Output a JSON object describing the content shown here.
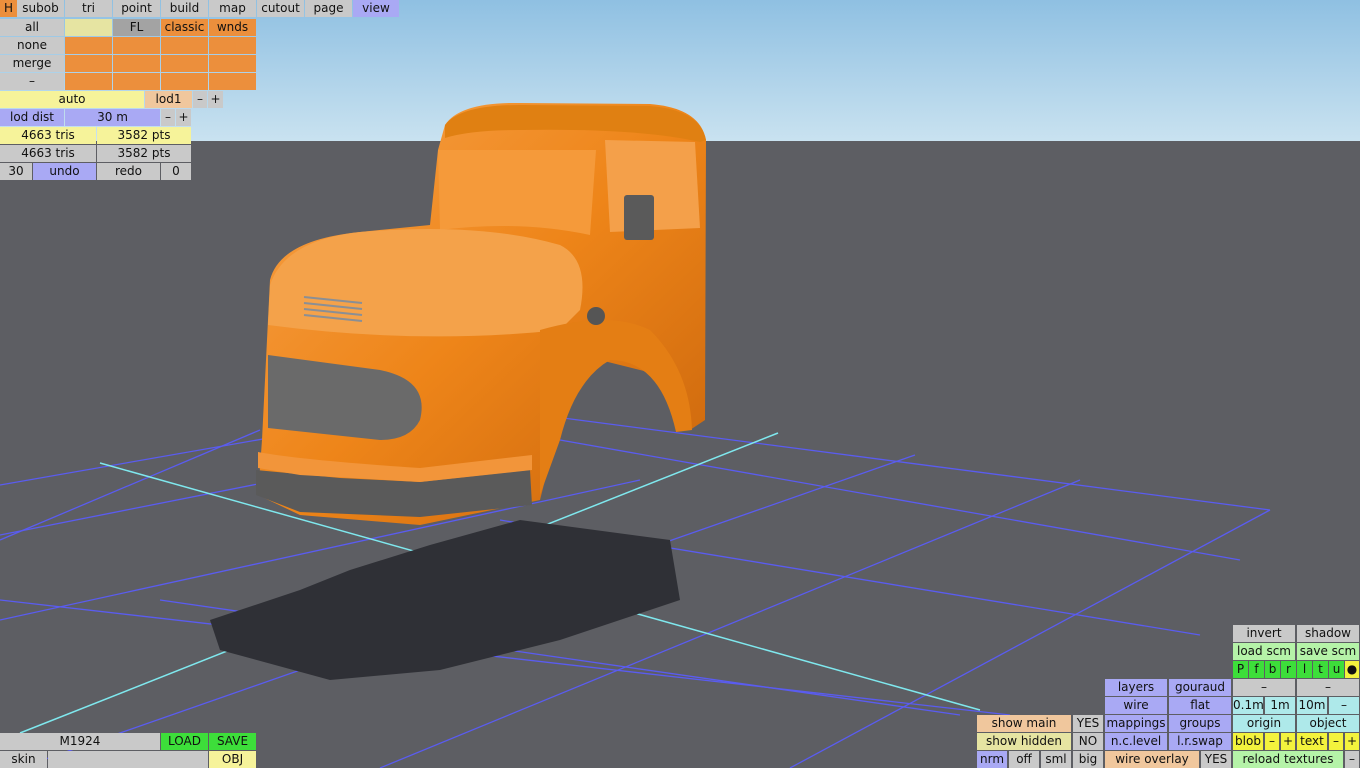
{
  "tabs": {
    "h": "H",
    "subob": "subob",
    "tri": "tri",
    "point": "point",
    "build": "build",
    "map": "map",
    "cutout": "cutout",
    "page": "page",
    "view": "view"
  },
  "selection": {
    "all": "all",
    "none": "none",
    "merge": "merge",
    "minus": "–",
    "fl": "FL",
    "classic": "classic",
    "wnds": "wnds"
  },
  "lod": {
    "auto": "auto",
    "lod": "lod1",
    "minus": "–",
    "plus": "+",
    "dist_label": "lod dist",
    "dist_value": "30 m"
  },
  "stats": {
    "tris1": "4663 tris",
    "pts1": "3582 pts",
    "tris2": "4663 tris",
    "pts2": "3582 pts"
  },
  "history": {
    "count": "30",
    "undo": "undo",
    "redo": "redo",
    "redo_count": "0"
  },
  "file": {
    "name": "M1924",
    "load": "LOAD",
    "save": "SAVE",
    "skin": "skin",
    "obj": "OBJ"
  },
  "right": {
    "invert": "invert",
    "shadow": "shadow",
    "load_scm": "load scm",
    "save_scm": "save scm",
    "views": [
      "P",
      "f",
      "b",
      "r",
      "l",
      "t",
      "u",
      "●"
    ],
    "layers": "layers",
    "gouraud": "gouraud",
    "dash1": "–",
    "dash2": "–",
    "wire": "wire",
    "flat": "flat",
    "step1": "0.1m",
    "step2": "1m",
    "step3": "10m",
    "step_minus": "–",
    "show_main": "show main",
    "show_main_val": "YES",
    "mappings": "mappings",
    "groups": "groups",
    "origin": "origin",
    "object": "object",
    "show_hidden": "show hidden",
    "show_hidden_val": "NO",
    "nclevel": "n.c.level",
    "lrswap": "l.r.swap",
    "blob": "blob",
    "blob_minus": "–",
    "blob_plus": "+",
    "text": "text",
    "text_minus": "–",
    "text_plus": "+",
    "nrm": "nrm",
    "off": "off",
    "sml": "sml",
    "big": "big",
    "wire_overlay": "wire overlay",
    "wire_overlay_val": "YES",
    "reload": "reload textures",
    "reload_minus": "–"
  },
  "colors": {
    "sky_top": "#94c3e3",
    "ground": "#5d5e63",
    "truck": "#f08b1f",
    "grid": "#5a5cf0",
    "axis": "#7fe8ee"
  }
}
